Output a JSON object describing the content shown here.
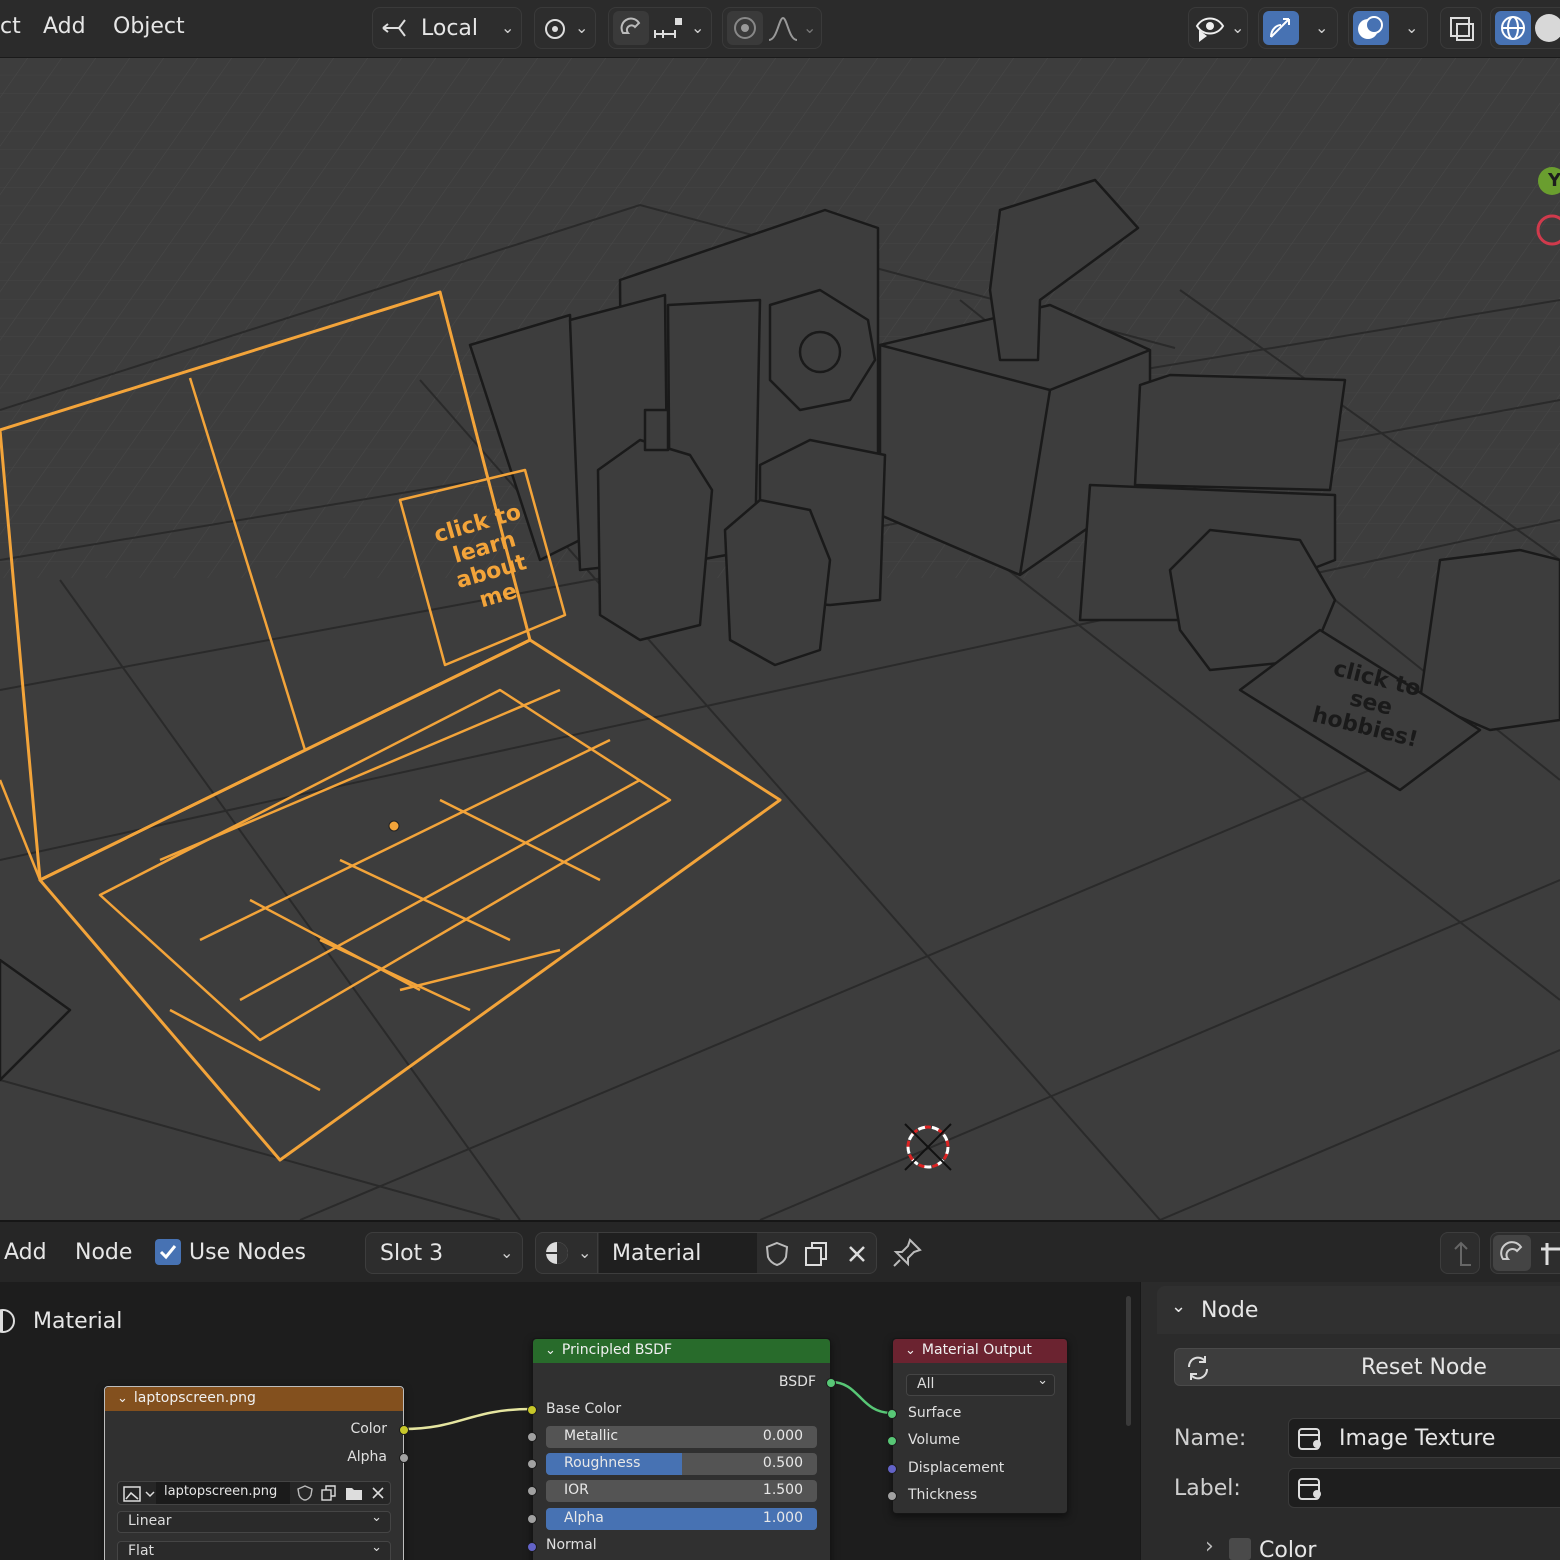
{
  "menu": {
    "partial": "ct",
    "add": "Add",
    "object": "Object"
  },
  "transform": {
    "orientation": "Local"
  },
  "viewport": {
    "label_laptop": [
      "click to",
      "learn about",
      "me"
    ],
    "label_hobbies": [
      "click to",
      "see",
      "hobbies!"
    ],
    "axis_y": "Y"
  },
  "node_editor": {
    "add": "Add",
    "node": "Node",
    "use_nodes": "Use Nodes",
    "slot": "Slot 3",
    "material_name": "Material",
    "breadcrumb": "Material"
  },
  "nodes": {
    "image": {
      "title": "laptopscreen.png",
      "out_color": "Color",
      "out_alpha": "Alpha",
      "image_name": "laptopscreen.png",
      "interpolation": "Linear",
      "projection": "Flat"
    },
    "bsdf": {
      "title": "Principled BSDF",
      "out": "BSDF",
      "base_color": "Base Color",
      "metallic_label": "Metallic",
      "metallic": "0.000",
      "roughness_label": "Roughness",
      "roughness": "0.500",
      "ior_label": "IOR",
      "ior": "1.500",
      "alpha_label": "Alpha",
      "alpha": "1.000",
      "normal": "Normal"
    },
    "output": {
      "title": "Material Output",
      "target": "All",
      "surface": "Surface",
      "volume": "Volume",
      "displacement": "Displacement",
      "thickness": "Thickness"
    }
  },
  "side_panel": {
    "section": "Node",
    "reset": "Reset Node",
    "name_label": "Name:",
    "name_value": "Image Texture",
    "label_label": "Label:",
    "color_section": "Color"
  },
  "colors": {
    "selection": "#f3a43a",
    "accent": "#4772b3",
    "node_image": "#83501e",
    "node_bsdf": "#286b2b",
    "node_output": "#6b2330"
  }
}
